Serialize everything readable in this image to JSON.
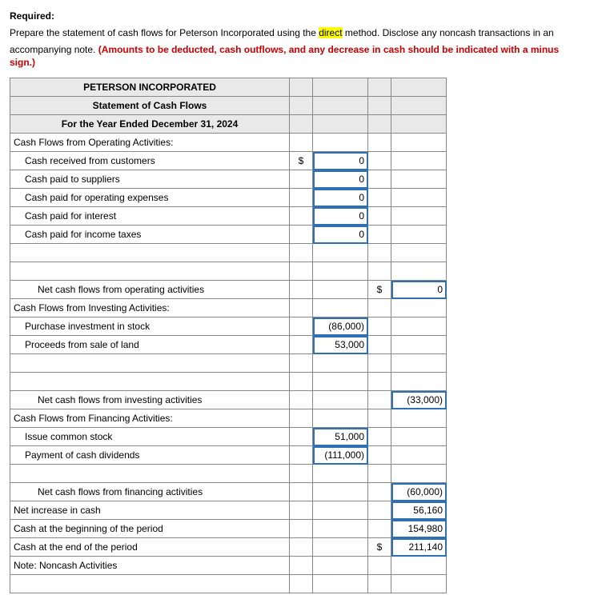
{
  "header": {
    "required_label": "Required:",
    "line1_a": "Prepare the statement of cash flows for Peterson Incorporated using the ",
    "line1_hl": "direct",
    "line1_b": " method. Disclose any noncash transactions in an",
    "line2_a": "accompanying note. ",
    "line2_red": "(Amounts to be deducted, cash outflows, and any decrease in cash should be indicated with a minus sign.)"
  },
  "titles": {
    "company": "PETERSON INCORPORATED",
    "statement": "Statement of Cash Flows",
    "period": "For the Year Ended December 31, 2024"
  },
  "rows": {
    "op_header": "Cash Flows from Operating Activities:",
    "op1": "Cash received from customers",
    "op2": "Cash paid to suppliers",
    "op3": "Cash paid for operating expenses",
    "op4": "Cash paid for interest",
    "op5": "Cash paid for income taxes",
    "op_net": "Net cash flows from operating activities",
    "inv_header": "Cash Flows from Investing Activities:",
    "inv1": "Purchase investment in stock",
    "inv2": "Proceeds from sale of land",
    "inv_net": "Net cash flows from investing activities",
    "fin_header": "Cash Flows from Financing Activities:",
    "fin1": "Issue common stock",
    "fin2": "Payment of cash dividends",
    "fin_net": "Net cash flows from financing activities",
    "net_inc": "Net increase in cash",
    "beg": "Cash at the beginning of the period",
    "end": "Cash at the end of the period",
    "note": "Note: Noncash Activities"
  },
  "sym": {
    "dollar": "$"
  },
  "vals": {
    "op1": "0",
    "op2": "0",
    "op3": "0",
    "op4": "0",
    "op5": "0",
    "op_net": "0",
    "inv1": "(86,000)",
    "inv2": "53,000",
    "inv_net": "(33,000)",
    "fin1": "51,000",
    "fin2": "(111,000)",
    "fin_net": "(60,000)",
    "net_inc": "56,160",
    "beg": "154,980",
    "end": "211,140"
  },
  "chart_data": {
    "type": "table",
    "title": "PETERSON INCORPORATED — Statement of Cash Flows — For the Year Ended December 31, 2024",
    "sections": [
      {
        "name": "Cash Flows from Operating Activities",
        "items": [
          {
            "label": "Cash received from customers",
            "value": 0
          },
          {
            "label": "Cash paid to suppliers",
            "value": 0
          },
          {
            "label": "Cash paid for operating expenses",
            "value": 0
          },
          {
            "label": "Cash paid for interest",
            "value": 0
          },
          {
            "label": "Cash paid for income taxes",
            "value": 0
          }
        ],
        "subtotal": {
          "label": "Net cash flows from operating activities",
          "value": 0
        }
      },
      {
        "name": "Cash Flows from Investing Activities",
        "items": [
          {
            "label": "Purchase investment in stock",
            "value": -86000
          },
          {
            "label": "Proceeds from sale of land",
            "value": 53000
          }
        ],
        "subtotal": {
          "label": "Net cash flows from investing activities",
          "value": -33000
        }
      },
      {
        "name": "Cash Flows from Financing Activities",
        "items": [
          {
            "label": "Issue common stock",
            "value": 51000
          },
          {
            "label": "Payment of cash dividends",
            "value": -111000
          }
        ],
        "subtotal": {
          "label": "Net cash flows from financing activities",
          "value": -60000
        }
      }
    ],
    "summary": [
      {
        "label": "Net increase in cash",
        "value": 56160
      },
      {
        "label": "Cash at the beginning of the period",
        "value": 154980
      },
      {
        "label": "Cash at the end of the period",
        "value": 211140
      }
    ],
    "note": "Note: Noncash Activities"
  }
}
